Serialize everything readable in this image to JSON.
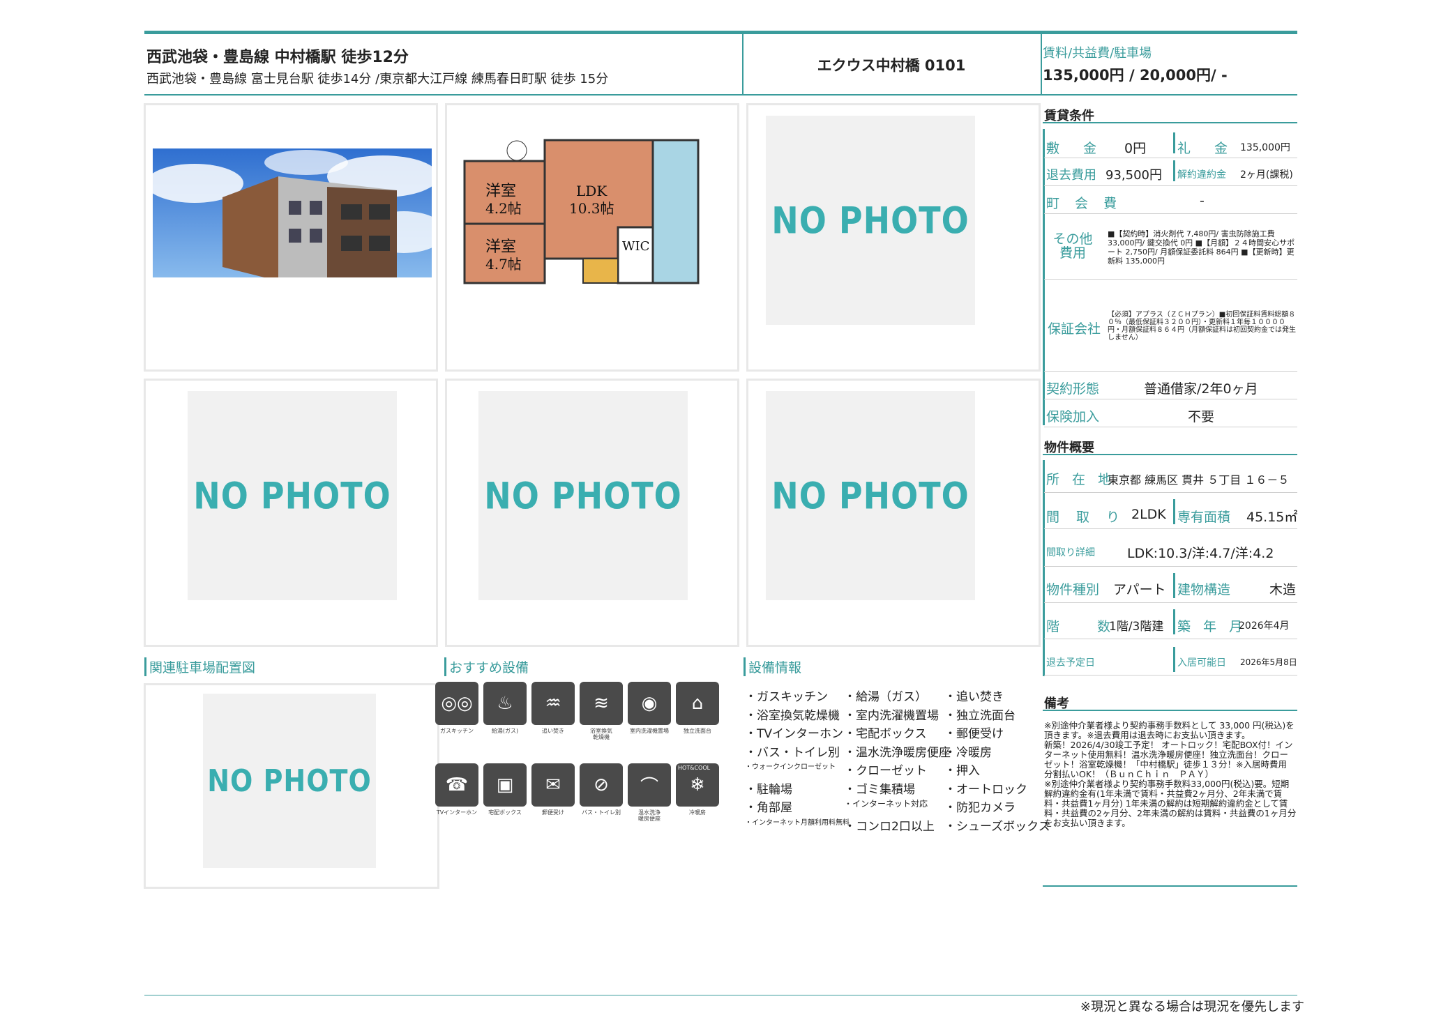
{
  "header": {
    "main_station": "西武池袋・豊島線 中村橋駅 徒歩12分",
    "sub_stations": "西武池袋・豊島線 富士見台駅 徒歩14分 /東京都大江戸線 練馬春日町駅 徒歩 15分",
    "building_name": "エクウス中村橋 0101",
    "rent_label": "賃料/共益費/駐車場",
    "rent_value": "135,000円 / 20,000円/ -"
  },
  "photos": {
    "no_photo_text": "NO PHOTO",
    "floorplan_labels": [
      "洋室 4.2帖",
      "LDK 10.3帖",
      "洋室 4.7帖",
      "WIC"
    ]
  },
  "conditions": {
    "title": "賃貸条件",
    "shikikin_label": "敷 金",
    "shikikin_value": "0円",
    "reikin_label": "礼 金",
    "reikin_value": "135,000円",
    "taikyo_label": "退去費用",
    "taikyo_value": "93,500円",
    "kaiyaku_label": "解約違約金",
    "kaiyaku_value": "2ヶ月(課税)",
    "chokai_label": "町 会 費",
    "chokai_value": "-",
    "other_label": "その他費用",
    "other_value": "■【契約時】消火剤代 7,480円/ 害虫防除施工費 33,000円/ 鍵交換代 0円 ■【月額】２４時間安心サポート 2,750円/ 月額保証委託料 864円 ■【更新時】更新料 135,000円",
    "guarantee_label": "保証会社",
    "guarantee_value": "【必須】アプラス（ＺＣＨプラン）■初回保証料賃料総額８０％（最低保証料３２００円）・更新料１年毎１００００円・月額保証料８６４円（月額保証料は初回契約金では発生しません）",
    "contract_label": "契約形態",
    "contract_value": "普通借家/2年0ヶ月",
    "insurance_label": "保険加入",
    "insurance_value": "不要"
  },
  "overview": {
    "title": "物件概要",
    "address_label": "所 在 地",
    "address_value": "東京都 練馬区 貫井 ５丁目 １６－５",
    "layout_label": "間 取 り",
    "layout_value": "2LDK",
    "area_label": "専有面積",
    "area_value": "45.15㎡",
    "layout_detail_label": "間取り詳細",
    "layout_detail_value": "LDK:10.3/洋:4.7/洋:4.2",
    "type_label": "物件種別",
    "type_value": "アパート",
    "structure_label": "建物構造",
    "structure_value": "木造",
    "floor_label": "階 数",
    "floor_value": "1階/3階建",
    "built_label": "築 年 月",
    "built_value": "2026年4月",
    "leave_label": "退去予定日",
    "leave_value": "",
    "move_label": "入居可能日",
    "move_value": "2026年5月8日"
  },
  "remarks": {
    "title": "備考",
    "text": "※別途仲介業者様より契約事務手数料として 33,000 円(税込)を頂きます。※退去費用は退去時にお支払い頂きます。\n新築！2026/4/30竣工予定！ オートロック！宅配BOX付！インターネット使用無料！温水洗浄暖房便座！独立洗面台！クローゼット！浴室乾燥機！「中村橋駅」徒歩１３分！※入居時費用　分割払いOK！（ＢｕｎＣｈｉｎ　ＰＡＹ）\n※別途仲介業者様より契約事務手数料33,000円(税込)要。短期解約違約金有(1年未満で賃料・共益費2ヶ月分、2年未満で賃料・共益費1ヶ月分) 1年未満の解約は短期解約違約金として賃料・共益費の2ヶ月分、2年未満の解約は賃料・共益費の1ヶ月分をお支払い頂きます。"
  },
  "sections": {
    "parking": "関連駐車場配置図",
    "recommended": "おすすめ設備",
    "equipment": "設備情報"
  },
  "recommended_icons": [
    {
      "icon": "gas-stove-icon",
      "label": "ガスキッチン"
    },
    {
      "icon": "water-heater-icon",
      "label": "給湯(ガス)"
    },
    {
      "icon": "reheat-bath-icon",
      "label": "追い焚き"
    },
    {
      "icon": "bath-dryer-icon",
      "label": "浴室換気\n乾燥機"
    },
    {
      "icon": "washer-icon",
      "label": "室内洗濯機置場"
    },
    {
      "icon": "vanity-icon",
      "label": "独立洗面台"
    },
    {
      "icon": "intercom-icon",
      "label": "TVインターホン"
    },
    {
      "icon": "delivery-box-icon",
      "label": "宅配ボックス"
    },
    {
      "icon": "mailbox-icon",
      "label": "郵便受け"
    },
    {
      "icon": "separate-bath-toilet-icon",
      "label": "バス・トイレ別"
    },
    {
      "icon": "washlet-icon",
      "label": "温水洗浄\n暖房便座"
    },
    {
      "icon": "aircon-icon",
      "label": "冷暖房"
    }
  ],
  "aircon_badge": "HOT&COOL",
  "equipment": [
    [
      "・ガスキッチン",
      "・給湯（ガス）",
      "・追い焚き"
    ],
    [
      "・浴室換気乾燥機",
      "・室内洗濯機置場",
      "・独立洗面台"
    ],
    [
      "・TVインターホン",
      "・宅配ボックス",
      "・郵便受け"
    ],
    [
      "・バス・トイレ別",
      "・温水洗浄暖房便座",
      "・冷暖房"
    ],
    [
      "・ウォークインクローゼット",
      "・クローゼット",
      "・押入"
    ],
    [
      "・駐輪場",
      "・ゴミ集積場",
      "・オートロック"
    ],
    [
      "・角部屋",
      "・インターネット対応",
      "・防犯カメラ"
    ],
    [
      "・インターネット月額利用料無料",
      "・コンロ2口以上",
      "・シューズボックス"
    ]
  ],
  "footer": "※現況と異なる場合は現況を優先します"
}
